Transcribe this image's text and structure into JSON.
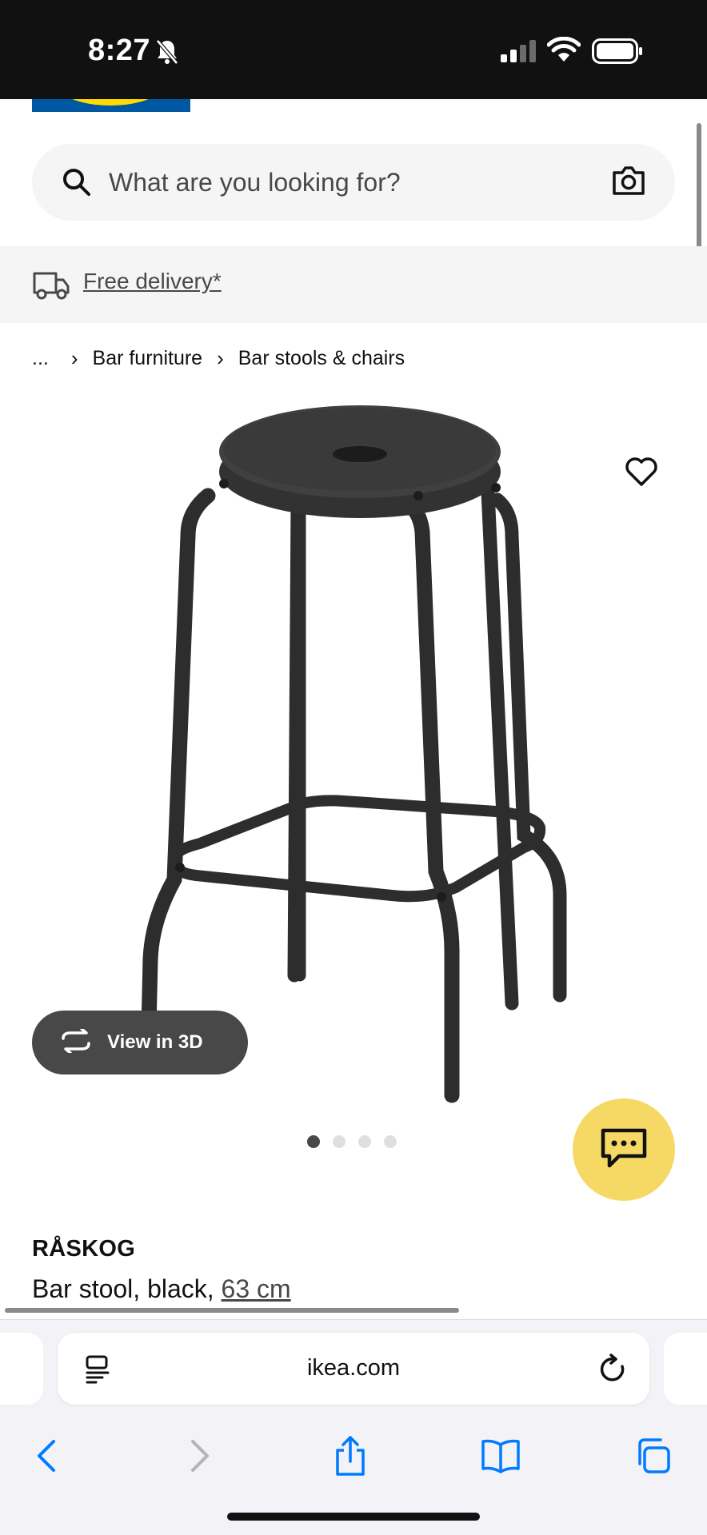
{
  "status_bar": {
    "time": "8:27",
    "icons": [
      "bell-slash-icon",
      "cellular-signal-icon",
      "wifi-icon",
      "battery-icon"
    ]
  },
  "search": {
    "placeholder": "What are you looking for?",
    "icon": "search-icon",
    "camera_icon": "camera-icon"
  },
  "delivery": {
    "label": "Free delivery*"
  },
  "breadcrumb": {
    "items": [
      "...",
      "Bar furniture",
      "Bar stools & chairs"
    ],
    "separator": "›"
  },
  "product": {
    "name": "RÅSKOG",
    "description": "Bar stool, black, ",
    "size": "63 cm",
    "image_subject": "black metal bar stool",
    "view3d_label": "View in 3D",
    "image_count": 4,
    "active_image": 1
  },
  "browser": {
    "url": "ikea.com"
  },
  "colors": {
    "ikea_blue": "#0058a3",
    "ikea_yellow": "#ffdb00",
    "chat_yellow": "#f5d964",
    "safari_blue": "#007aff"
  }
}
